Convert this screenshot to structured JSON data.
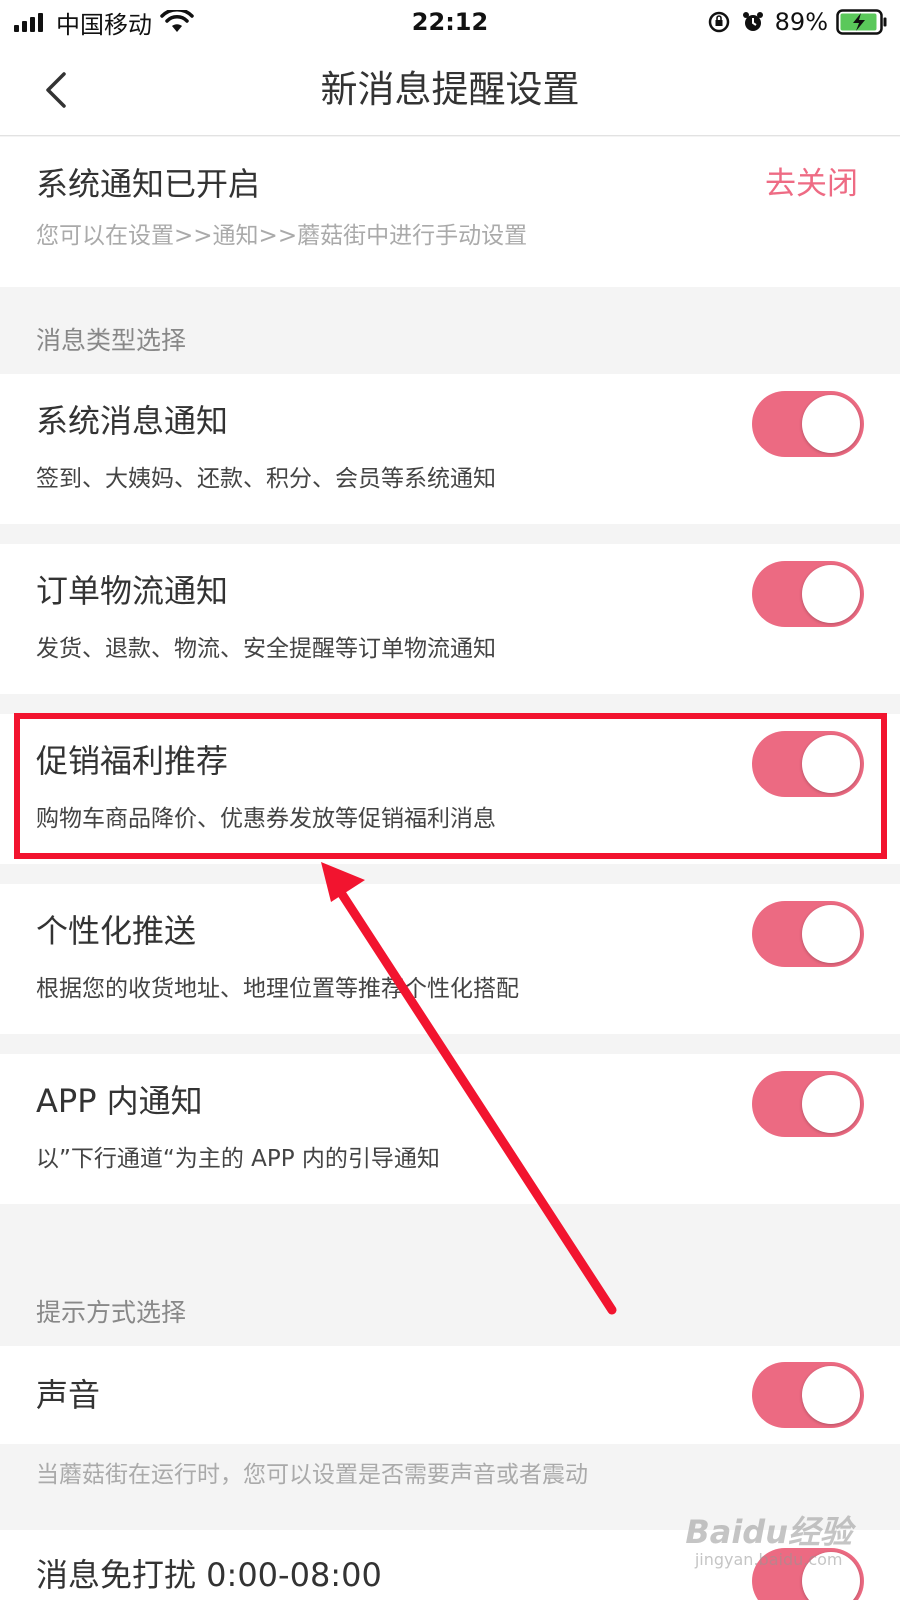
{
  "status_bar": {
    "carrier": "中国移动",
    "time": "22:12",
    "battery_percent": "89%"
  },
  "nav": {
    "title": "新消息提醒设置"
  },
  "system_notice": {
    "title": "系统通知已开启",
    "action": "去关闭",
    "subtitle": "您可以在设置>>通知>>蘑菇街中进行手动设置"
  },
  "message_types": {
    "label": "消息类型选择",
    "items": [
      {
        "title": "系统消息通知",
        "subtitle": "签到、大姨妈、还款、积分、会员等系统通知",
        "enabled": true
      },
      {
        "title": "订单物流通知",
        "subtitle": "发货、退款、物流、安全提醒等订单物流通知",
        "enabled": true
      },
      {
        "title": "促销福利推荐",
        "subtitle": "购物车商品降价、优惠券发放等促销福利消息",
        "enabled": true
      },
      {
        "title": "个性化推送",
        "subtitle": "根据您的收货地址、地理位置等推荐个性化搭配",
        "enabled": true
      },
      {
        "title": "APP 内通知",
        "subtitle": "以”下行通道“为主的 APP 内的引导通知",
        "enabled": true
      }
    ]
  },
  "reminder_modes": {
    "label": "提示方式选择",
    "sound": {
      "title": "声音",
      "enabled": true
    },
    "sound_hint": "当蘑菇街在运行时，您可以设置是否需要声音或者震动",
    "dnd": {
      "title": "消息免打扰 0:00-08:00",
      "enabled": true
    }
  },
  "watermark": {
    "logo": "Baidu经验",
    "url": "jingyan.baidu.com"
  },
  "colors": {
    "accent": "#ec6a82",
    "link": "#ee6b84",
    "annotation": "#f2142f"
  }
}
